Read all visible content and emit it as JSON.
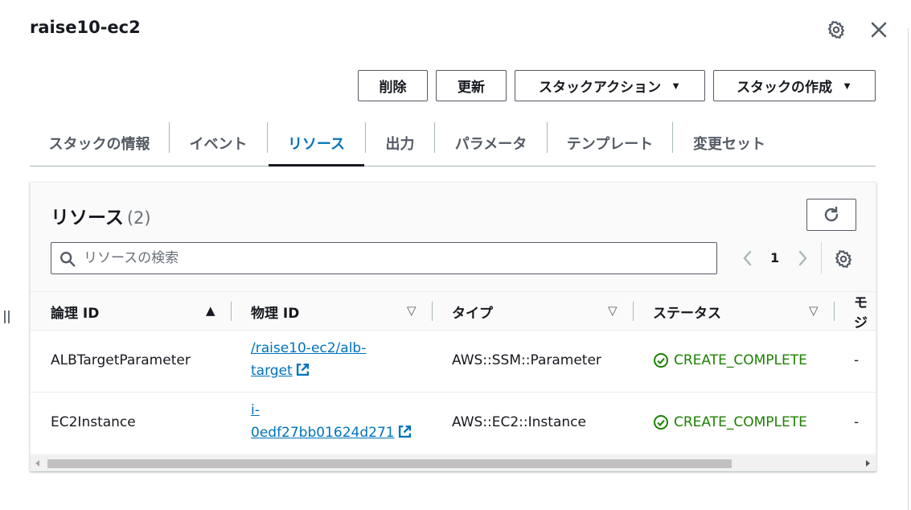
{
  "header": {
    "title": "raise10-ec2",
    "settings_icon": "gear-icon",
    "close_icon": "close-icon"
  },
  "actions": {
    "delete_label": "削除",
    "update_label": "更新",
    "stack_actions_label": "スタックアクション",
    "create_stack_label": "スタックの作成",
    "caret_glyph": "▼"
  },
  "tabs": [
    {
      "label": "スタックの情報",
      "active": false
    },
    {
      "label": "イベント",
      "active": false
    },
    {
      "label": "リソース",
      "active": true
    },
    {
      "label": "出力",
      "active": false
    },
    {
      "label": "パラメータ",
      "active": false
    },
    {
      "label": "テンプレート",
      "active": false
    },
    {
      "label": "変更セット",
      "active": false
    }
  ],
  "resources": {
    "title": "リソース",
    "count": "(2)",
    "search": {
      "placeholder": "リソースの検索",
      "value": ""
    },
    "pagination": {
      "current_page": "1"
    },
    "columns": [
      {
        "label": "論理 ID",
        "sort": "ascending",
        "sort_glyph": "▲"
      },
      {
        "label": "物理 ID",
        "sort": "none",
        "sort_glyph": "▽"
      },
      {
        "label": "タイプ",
        "sort": "none",
        "sort_glyph": "▽"
      },
      {
        "label": "ステータス",
        "sort": "none",
        "sort_glyph": "▽"
      },
      {
        "label": "モジ",
        "sort": "none",
        "sort_glyph": ""
      }
    ],
    "rows": [
      {
        "logical_id": "ALBTargetParameter",
        "physical_id_line1": "/raise10-ec2/alb-",
        "physical_id_line2": "target",
        "type": "AWS::SSM::Parameter",
        "status": "CREATE_COMPLETE",
        "module": "-"
      },
      {
        "logical_id": "EC2Instance",
        "physical_id_line1": "i-",
        "physical_id_line2": "0edf27bb01624d271",
        "type": "AWS::EC2::Instance",
        "status": "CREATE_COMPLETE",
        "module": "-"
      }
    ]
  },
  "colors": {
    "link": "#0073bb",
    "success": "#1d8102",
    "text": "#16191f",
    "secondary_text": "#545b64"
  }
}
